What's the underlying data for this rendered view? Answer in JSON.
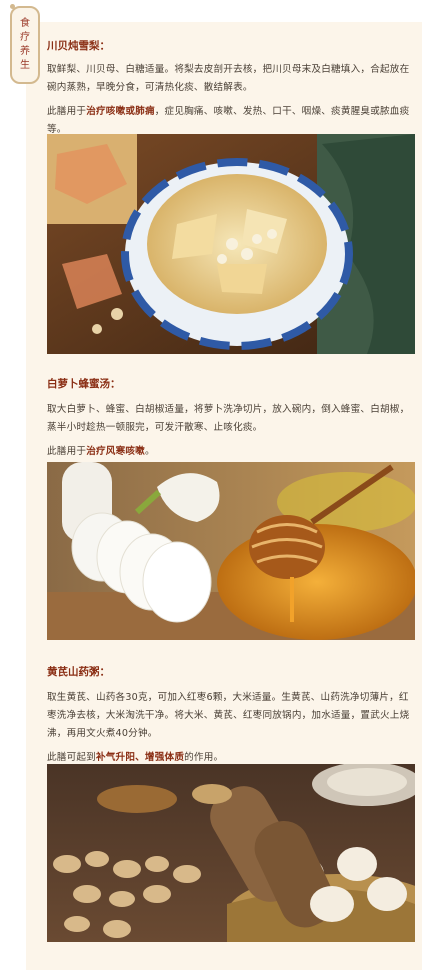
{
  "tag": [
    "食",
    "疗",
    "养",
    "生"
  ],
  "sections": [
    {
      "title": "川贝炖雪梨：",
      "recipe": "取鲜梨、川贝母、白糖适量。将梨去皮剖开去核，把川贝母末及白糖填入，合起放在碗内蒸熟，早晚分食，可清热化痰、散结解表。",
      "use_pre": "此膳用于",
      "use_em": "治疗咳嗽或肺痈",
      "use_post": "，症见胸痛、咳嗽、发热、口干、咽燥、痰黄腥臭或脓血痰等。"
    },
    {
      "title": "白萝卜蜂蜜汤：",
      "recipe": "取大白萝卜、蜂蜜、白胡椒适量，将萝卜洗净切片，放入碗内，倒入蜂蜜、白胡椒，蒸半小时趁热一顿服完，可发汗散寒、止咳化痰。",
      "use_pre": "此膳用于",
      "use_em": "治疗风寒咳嗽",
      "use_post": "。"
    },
    {
      "title": "黄芪山药粥：",
      "recipe": "取生黄芪、山药各30克，可加入红枣6颗，大米适量。生黄芪、山药洗净切薄片，红枣洗净去核，大米淘洗干净。将大米、黄芪、红枣同放锅内，加水适量，置武火上烧沸，再用文火煮40分钟。",
      "use_pre": "此膳可起到",
      "use_em": "补气升阳、增强体质",
      "use_post": "的作用。"
    }
  ]
}
